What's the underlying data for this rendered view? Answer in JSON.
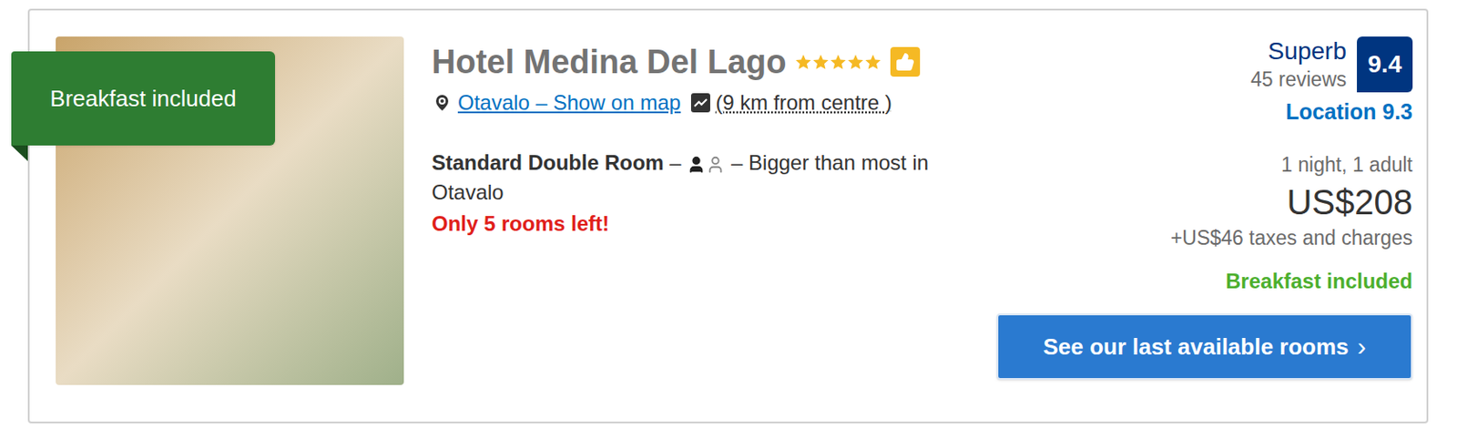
{
  "badge": {
    "label": "Breakfast included"
  },
  "hotel": {
    "name": "Hotel Medina Del Lago",
    "stars": 5,
    "location": "Otavalo – Show on map",
    "distance": "(9 km from centre )"
  },
  "room": {
    "name": "Standard Double Room",
    "separator": "–",
    "occupancy": [
      {
        "filled": true
      },
      {
        "filled": false
      }
    ],
    "note": "– Bigger than most in Otavalo",
    "availability": "Only 5 rooms left!"
  },
  "rating": {
    "label": "Superb",
    "reviews": "45 reviews",
    "score": "9.4",
    "location_score": "Location 9.3"
  },
  "price": {
    "stay": "1 night, 1 adult",
    "amount": "US$208",
    "taxes": "+US$46 taxes and charges",
    "meal": "Breakfast included"
  },
  "button": {
    "label": "See our last available rooms",
    "icon": "›"
  }
}
